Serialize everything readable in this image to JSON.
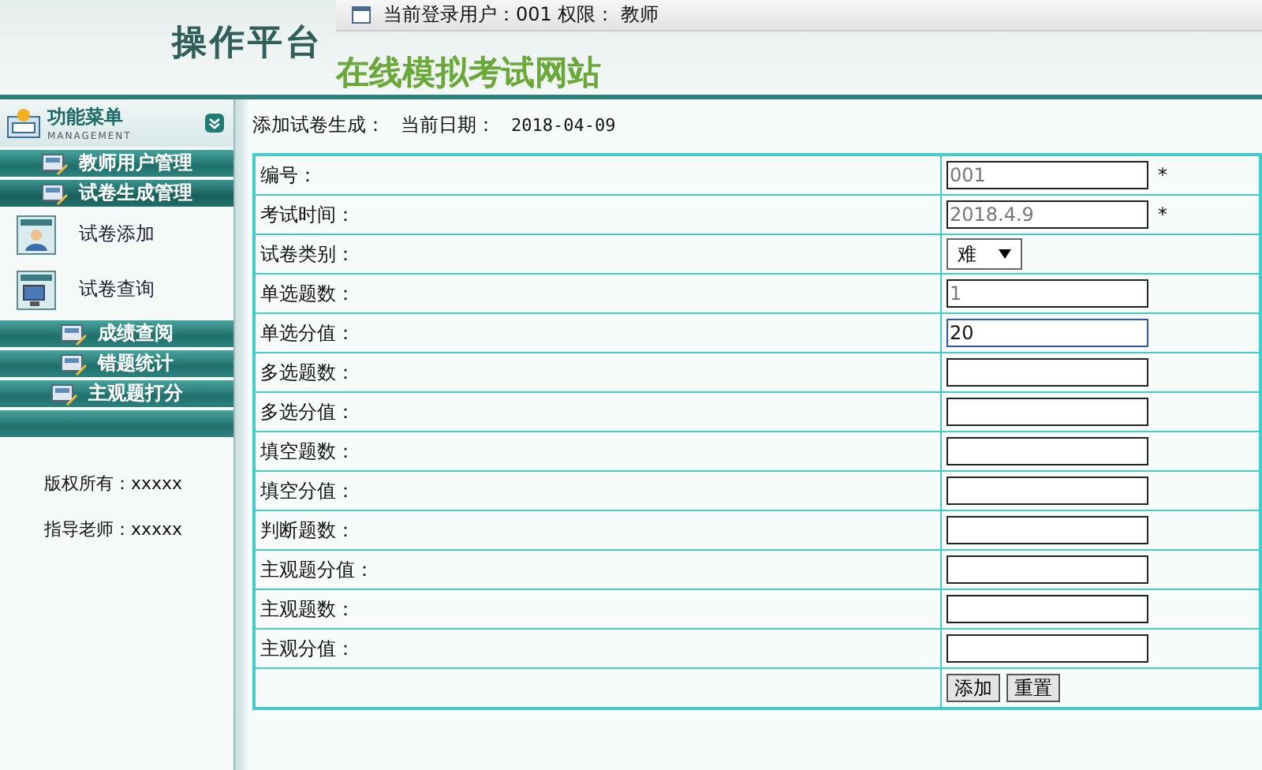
{
  "header": {
    "platform_title": "操作平台",
    "site_title": "在线模拟考试网站",
    "user_info": "当前登录用户：001  权限：  教师"
  },
  "sidebar": {
    "menu_title": "功能菜单",
    "menu_subtitle": "MANAGEMENT",
    "sections": [
      {
        "label": "教师用户管理",
        "expanded": false
      },
      {
        "label": "试卷生成管理",
        "expanded": true,
        "children": [
          {
            "label": "试卷添加",
            "kind": "add"
          },
          {
            "label": "试卷查询",
            "kind": "query"
          }
        ]
      },
      {
        "label": "成绩查阅",
        "expanded": false
      },
      {
        "label": "错题统计",
        "expanded": false
      },
      {
        "label": "主观题打分",
        "expanded": false
      }
    ],
    "footer": [
      "版权所有：xxxxx",
      "指导老师：xxxxx"
    ]
  },
  "page": {
    "title": "添加试卷生成：",
    "date_label": "当前日期：",
    "date": "2018-04-09"
  },
  "form": [
    {
      "label": "编号：",
      "kind": "text",
      "value": "001",
      "readonly": true,
      "required": true,
      "focused": false
    },
    {
      "label": "考试时间：",
      "kind": "text",
      "value": "2018.4.9",
      "readonly": true,
      "required": true,
      "focused": false
    },
    {
      "label": "试卷类别：",
      "kind": "select",
      "value": "难"
    },
    {
      "label": "单选题数：",
      "kind": "text",
      "value": "1",
      "readonly": true,
      "focused": false
    },
    {
      "label": "单选分值：",
      "kind": "text",
      "value": "20",
      "readonly": false,
      "focused": true
    },
    {
      "label": "多选题数：",
      "kind": "text",
      "focused": false
    },
    {
      "label": "多选分值：",
      "kind": "text",
      "focused": false
    },
    {
      "label": "填空题数：",
      "kind": "text",
      "focused": false
    },
    {
      "label": "填空分值：",
      "kind": "text",
      "focused": false
    },
    {
      "label": "判断题数：",
      "kind": "text",
      "focused": false
    },
    {
      "label": "主观题分值：",
      "kind": "text",
      "focused": false
    },
    {
      "label": "主观题数：",
      "kind": "text",
      "focused": false
    },
    {
      "label": "主观分值：",
      "kind": "text",
      "focused": false
    }
  ],
  "required_mark": "*",
  "buttons": [
    "添加",
    "重置"
  ]
}
